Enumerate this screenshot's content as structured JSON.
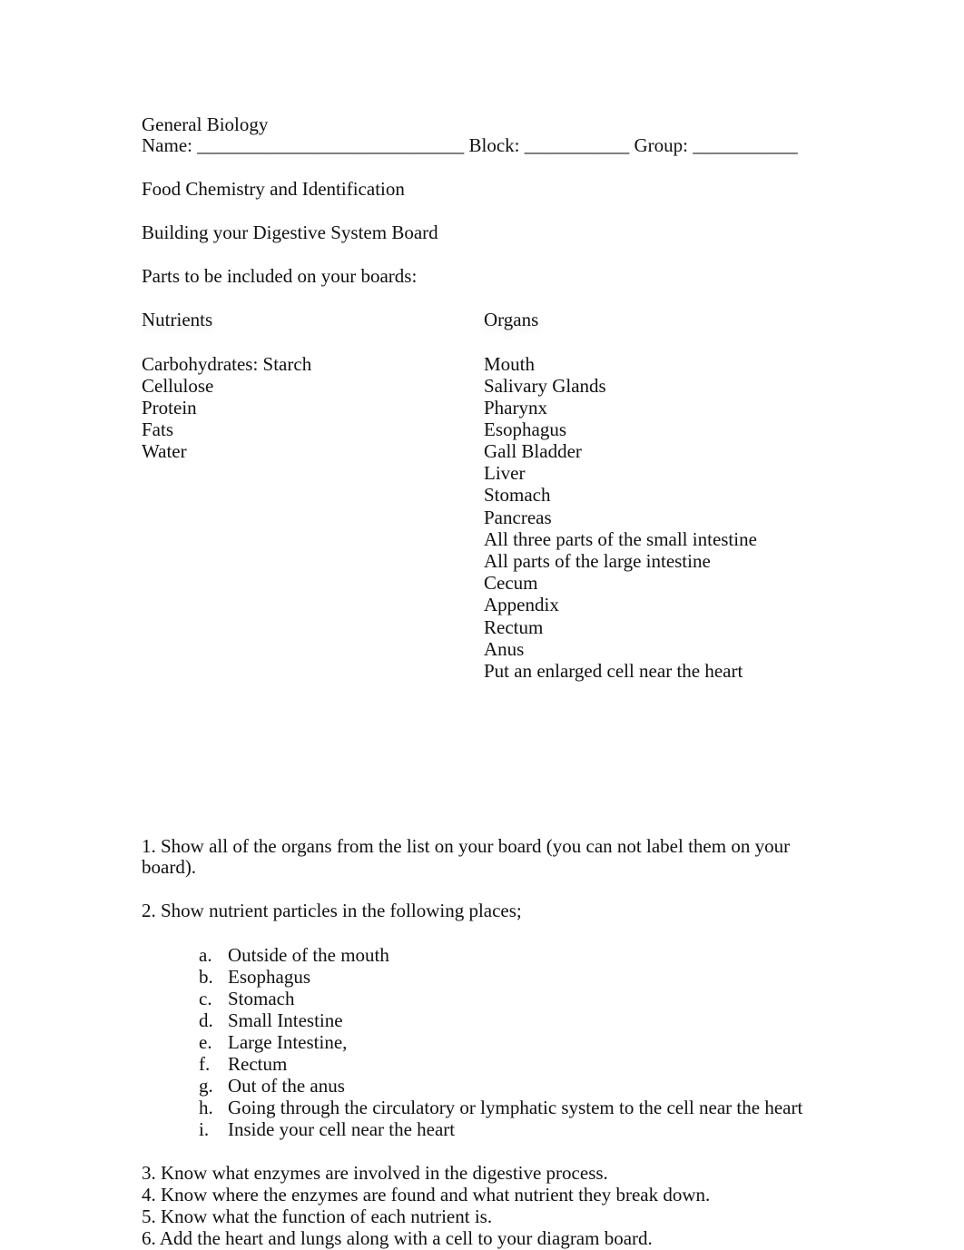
{
  "header": {
    "course": "General Biology",
    "name_label": "Name: ____________________________",
    "block_label": "Block: ___________",
    "group_label": "Group: ___________"
  },
  "title": "Food Chemistry and Identification",
  "subtitle": "Building your Digestive System Board",
  "intro": "Parts to be included on your boards:",
  "columns": {
    "nutrients_heading": "Nutrients",
    "organs_heading": "Organs"
  },
  "nutrients": [
    "Carbohydrates: Starch",
    "Cellulose",
    "Protein",
    "Fats",
    "Water"
  ],
  "organs": [
    "Mouth",
    "Salivary Glands",
    "Pharynx",
    "Esophagus",
    "Gall Bladder",
    "Liver",
    "Stomach",
    "Pancreas",
    "All three parts of the small intestine",
    "All parts of the large intestine",
    "Cecum",
    "Appendix",
    "Rectum",
    "Anus",
    "Put an enlarged cell near the heart"
  ],
  "instructions": {
    "item1_line1": "1. Show all of the organs from the list on your board (you can not label them on your",
    "item1_line2": "board).",
    "item2": "2. Show nutrient particles in the following places;",
    "places": [
      {
        "marker": "a.",
        "text": "Outside of the mouth"
      },
      {
        "marker": "b.",
        "text": "Esophagus"
      },
      {
        "marker": "c.",
        "text": "Stomach"
      },
      {
        "marker": "d.",
        "text": "Small Intestine"
      },
      {
        "marker": "e.",
        "text": "Large Intestine,"
      },
      {
        "marker": "f.",
        "text": "Rectum"
      },
      {
        "marker": "g.",
        "text": "Out of the anus"
      },
      {
        "marker": "h.",
        "text": "Going through the circulatory or lymphatic system to the cell near the heart"
      },
      {
        "marker": "i.",
        "text": "Inside your cell near the heart"
      }
    ],
    "tasks": [
      "3. Know what enzymes are involved in the digestive process.",
      "4. Know where the enzymes are found and what nutrient they break down.",
      "5. Know what the function of each nutrient is.",
      "6. Add the heart and lungs along with a cell to your diagram board."
    ]
  }
}
